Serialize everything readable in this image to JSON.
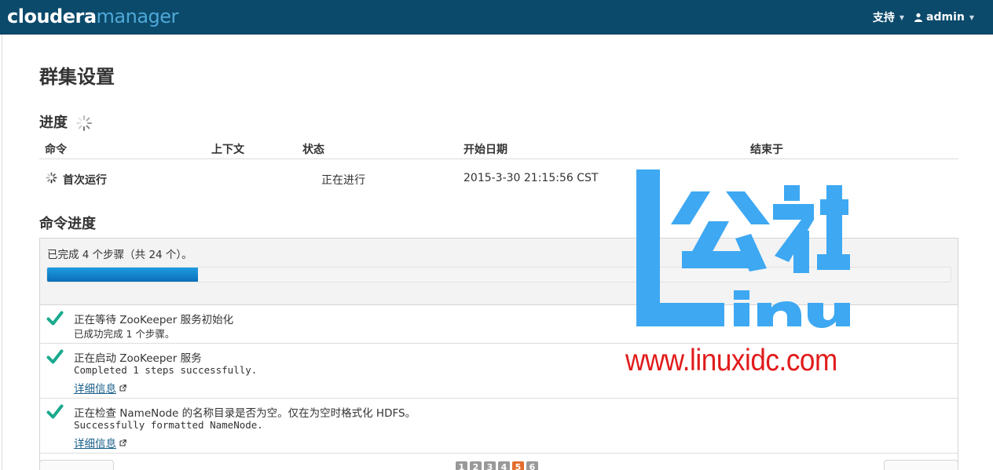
{
  "navbar": {
    "logo_part1": "cloudera",
    "logo_part2": "manager",
    "support_label": "支持",
    "user_label": "admin"
  },
  "page_title": "群集设置",
  "progress_section": {
    "heading": "进度",
    "columns": [
      "命令",
      "上下文",
      "状态",
      "开始日期",
      "结束于"
    ],
    "row": {
      "command": "首次运行",
      "context": "",
      "status": "正在进行",
      "start_date": "2015-3-30 21:15:56 CST",
      "end": ""
    }
  },
  "command_progress": {
    "heading": "命令进度",
    "summary": "已完成 4 个步骤（共 24 个）。",
    "progress_fraction": 0.1667,
    "steps": [
      {
        "title": "正在等待 ZooKeeper 服务初始化",
        "message": "已成功完成 1 个步骤。",
        "details": ""
      },
      {
        "title": "正在启动 ZooKeeper 服务",
        "message": "Completed 1 steps successfully.",
        "details": "详细信息"
      },
      {
        "title": "正在检查 NameNode 的名称目录是否为空。仅在为空时格式化 HDFS。",
        "message": "Successfully formatted NameNode.",
        "details": "详细信息"
      }
    ]
  },
  "watermark": {
    "brand_cjk": "公社",
    "brand_latin": "inux",
    "url": "www.linuxidc.com"
  },
  "pager": {
    "pages": [
      "1",
      "2",
      "3",
      "4",
      "5",
      "6"
    ],
    "active": "5"
  },
  "colors": {
    "navbar": "#0b4a6b",
    "check": "#1aaa8e",
    "progress": "#1283cc",
    "active_page": "#e46d2d",
    "watermark_blue": "#3ea8f2",
    "watermark_red": "#e11b1b"
  }
}
